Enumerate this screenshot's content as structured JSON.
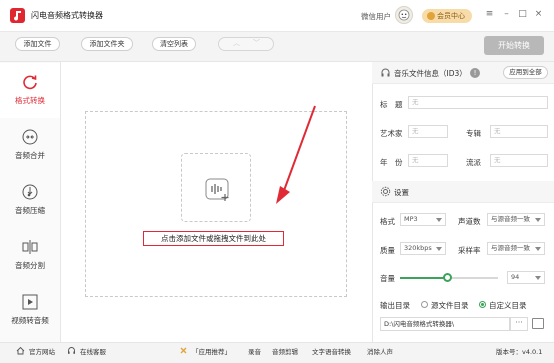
{
  "app": {
    "title": "闪电音频格式转换器"
  },
  "header": {
    "user_label": "微信用户",
    "vip_label": "会员中心"
  },
  "window_controls": {
    "menu": "≡",
    "minimize": "–",
    "maximize": "□",
    "close": "×"
  },
  "toolbar": {
    "add_file": "添加文件",
    "add_folder": "添加文件夹",
    "clear_list": "清空列表",
    "start": "开始转换"
  },
  "sidebar": {
    "items": [
      {
        "label": "格式转换",
        "icon": "refresh-icon",
        "active": true
      },
      {
        "label": "音频合并",
        "icon": "merge-icon",
        "active": false
      },
      {
        "label": "音频压缩",
        "icon": "compress-icon",
        "active": false
      },
      {
        "label": "音频分割",
        "icon": "split-icon",
        "active": false
      },
      {
        "label": "视频转音频",
        "icon": "play-icon",
        "active": false
      }
    ]
  },
  "main": {
    "drop_hint": "点击添加文件或拖拽文件到此处"
  },
  "id3": {
    "title": "音乐文件信息（ID3）",
    "apply_all": "应用到全部",
    "title_label": "标　题",
    "artist_label": "艺术家",
    "album_label": "专辑",
    "year_label": "年　份",
    "genre_label": "流派",
    "placeholder": "无"
  },
  "settings": {
    "title": "设置",
    "format_label": "格式",
    "format_value": "MP3",
    "channels_label": "声道数",
    "channels_value": "与源音频一致",
    "quality_label": "质量",
    "quality_value": "320kbps",
    "samplerate_label": "采样率",
    "samplerate_value": "与源音频一致",
    "volume_label": "音量",
    "volume_value": "94",
    "volume_level": 0.47,
    "output_label": "输出目录",
    "output_option_source": "源文件目录",
    "output_option_custom": "自定义目录",
    "output_selected": "custom",
    "output_path": "D:\\闪电音频格式转换器\\",
    "browse": "···"
  },
  "footer": {
    "website": "官方网站",
    "support": "在线客服",
    "recommend": "「应用推荐」",
    "links": [
      "录音",
      "音频剪辑",
      "文字语音转换",
      "消除人声"
    ],
    "version": "版本号：v4.0.1"
  },
  "colors": {
    "accent": "#e02a35",
    "green": "#3ba35a"
  }
}
